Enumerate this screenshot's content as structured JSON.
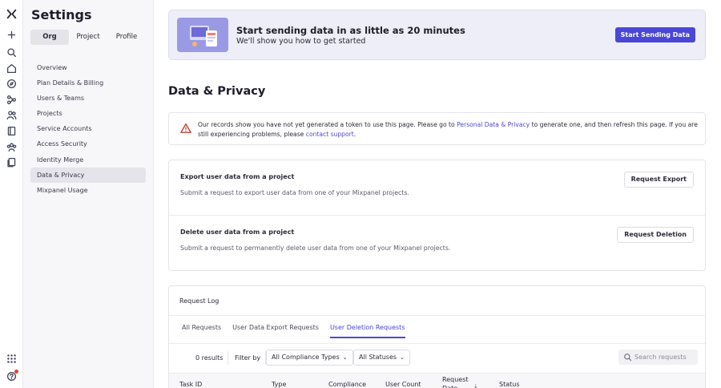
{
  "rail": {
    "icons": [
      "logo-icon",
      "plus-icon",
      "search-icon",
      "home-icon",
      "compass-icon",
      "flow-icon",
      "users-icon",
      "book-icon",
      "group-icon",
      "pages-icon",
      "grid-icon",
      "help-icon"
    ]
  },
  "sidebar": {
    "title": "Settings",
    "tabs": [
      {
        "label": "Org",
        "active": true
      },
      {
        "label": "Project",
        "active": false
      },
      {
        "label": "Profile",
        "active": false
      }
    ],
    "items": [
      {
        "label": "Overview"
      },
      {
        "label": "Plan Details & Billing"
      },
      {
        "label": "Users & Teams"
      },
      {
        "label": "Projects"
      },
      {
        "label": "Service Accounts"
      },
      {
        "label": "Access Security"
      },
      {
        "label": "Identity Merge"
      },
      {
        "label": "Data & Privacy",
        "active": true
      },
      {
        "label": "Mixpanel Usage"
      }
    ]
  },
  "banner": {
    "title": "Start sending data in as little as 20 minutes",
    "subtitle": "We'll show you how to get started",
    "button": "Start Sending Data"
  },
  "page": {
    "title": "Data & Privacy"
  },
  "alert": {
    "text_before": "Our records show you have not yet generated a token to use this page. Please go to ",
    "link1": "Personal Data & Privacy",
    "text_middle": " to generate one, and then refresh this page. If you are still experiencing problems, please ",
    "link2": "contact support",
    "text_after": "."
  },
  "export": {
    "heading": "Export user data from a project",
    "desc": "Submit a request to export user data from one of your Mixpanel projects.",
    "button": "Request Export"
  },
  "deletion": {
    "heading": "Delete user data from a project",
    "desc": "Submit a request to permanently delete user data from one of your Mixpanel projects.",
    "button": "Request Deletion"
  },
  "log": {
    "title": "Request Log",
    "tabs": [
      {
        "label": "All Requests",
        "active": false
      },
      {
        "label": "User Data Export Requests",
        "active": false
      },
      {
        "label": "User Deletion Requests",
        "active": true
      }
    ],
    "results": "0 results",
    "filter_by": "Filter by",
    "compliance_filter": "All Compliance Types",
    "status_filter": "All Statuses",
    "search_placeholder": "Search requests",
    "columns": [
      "Task ID",
      "Type",
      "Compliance",
      "User Count",
      "Request Date",
      "Status"
    ]
  },
  "colors": {
    "accent": "#4b47d6",
    "banner_bg": "#eeeef9",
    "warning": "#c0392b"
  }
}
